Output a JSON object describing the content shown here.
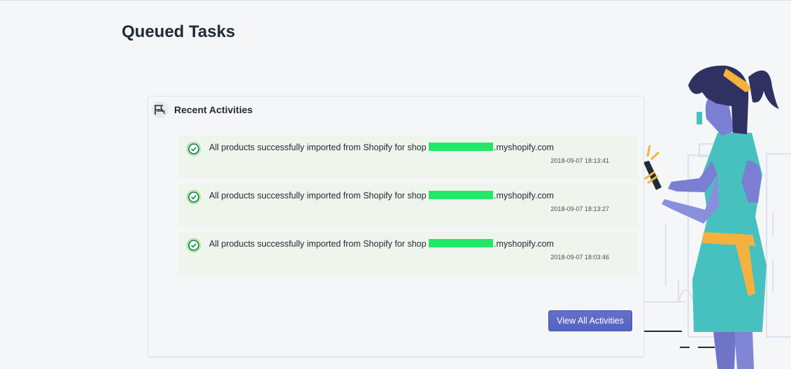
{
  "page": {
    "title": "Queued Tasks"
  },
  "activities_card": {
    "title": "Recent Activities",
    "header_icon": "flag-icon",
    "items": [
      {
        "icon": "check-circle-icon",
        "message_prefix": "All products successfully imported from Shopify for shop ",
        "message_suffix": ".myshopify.com",
        "timestamp": "2018-09-07 18:13:41"
      },
      {
        "icon": "check-circle-icon",
        "message_prefix": "All products successfully imported from Shopify for shop ",
        "message_suffix": ".myshopify.com",
        "timestamp": "2018-09-07 18:13:27"
      },
      {
        "icon": "check-circle-icon",
        "message_prefix": "All products successfully imported from Shopify for shop ",
        "message_suffix": ".myshopify.com",
        "timestamp": "2018-09-07 18:03:46"
      }
    ],
    "view_all_label": "View All Activities"
  },
  "colors": {
    "success_bg": "#eff5ec",
    "success_icon": "#108043",
    "primary_button": "#5c6ac4",
    "redaction": "#22e86a"
  }
}
